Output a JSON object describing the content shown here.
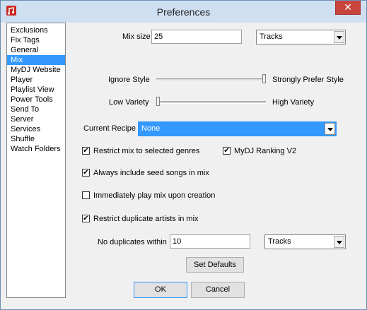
{
  "window": {
    "title": "Preferences",
    "close_label": "✕"
  },
  "sidebar": {
    "items": [
      {
        "label": "Exclusions",
        "selected": false
      },
      {
        "label": "Fix Tags",
        "selected": false
      },
      {
        "label": "General",
        "selected": false
      },
      {
        "label": "Mix",
        "selected": true
      },
      {
        "label": "MyDJ Website",
        "selected": false
      },
      {
        "label": "Player",
        "selected": false
      },
      {
        "label": "Playlist View",
        "selected": false
      },
      {
        "label": "Power Tools",
        "selected": false
      },
      {
        "label": "Send To",
        "selected": false
      },
      {
        "label": "Server",
        "selected": false
      },
      {
        "label": "Services",
        "selected": false
      },
      {
        "label": "Shuffle",
        "selected": false
      },
      {
        "label": "Watch Folders",
        "selected": false
      }
    ]
  },
  "mix": {
    "mix_size_label": "Mix size",
    "mix_size_value": "25",
    "mix_unit": "Tracks",
    "style_slider": {
      "left_label": "Ignore Style",
      "right_label": "Strongly Prefer Style",
      "level": 1.0
    },
    "variety_slider": {
      "left_label": "Low Variety",
      "right_label": "High Variety",
      "level": 0.0
    },
    "recipe_label": "Current Recipe",
    "recipe_value": "None",
    "restrict_genres": {
      "label": "Restrict mix to selected genres",
      "checked": true
    },
    "mydj_ranking": {
      "label": "MyDJ Ranking V2",
      "checked": true
    },
    "include_seed": {
      "label": "Always include seed songs in mix",
      "checked": true
    },
    "play_immediately": {
      "label": "Immediately play mix upon creation",
      "checked": false
    },
    "restrict_duplicates": {
      "label": "Restrict duplicate artists in mix",
      "checked": true
    },
    "no_duplicates_label": "No duplicates within",
    "no_duplicates_value": "10",
    "no_duplicates_unit": "Tracks",
    "set_defaults_label": "Set Defaults"
  },
  "footer": {
    "ok_label": "OK",
    "cancel_label": "Cancel"
  },
  "colors": {
    "selection": "#3399ff",
    "close": "#c7453c",
    "titlebar": "#cfdff2"
  }
}
